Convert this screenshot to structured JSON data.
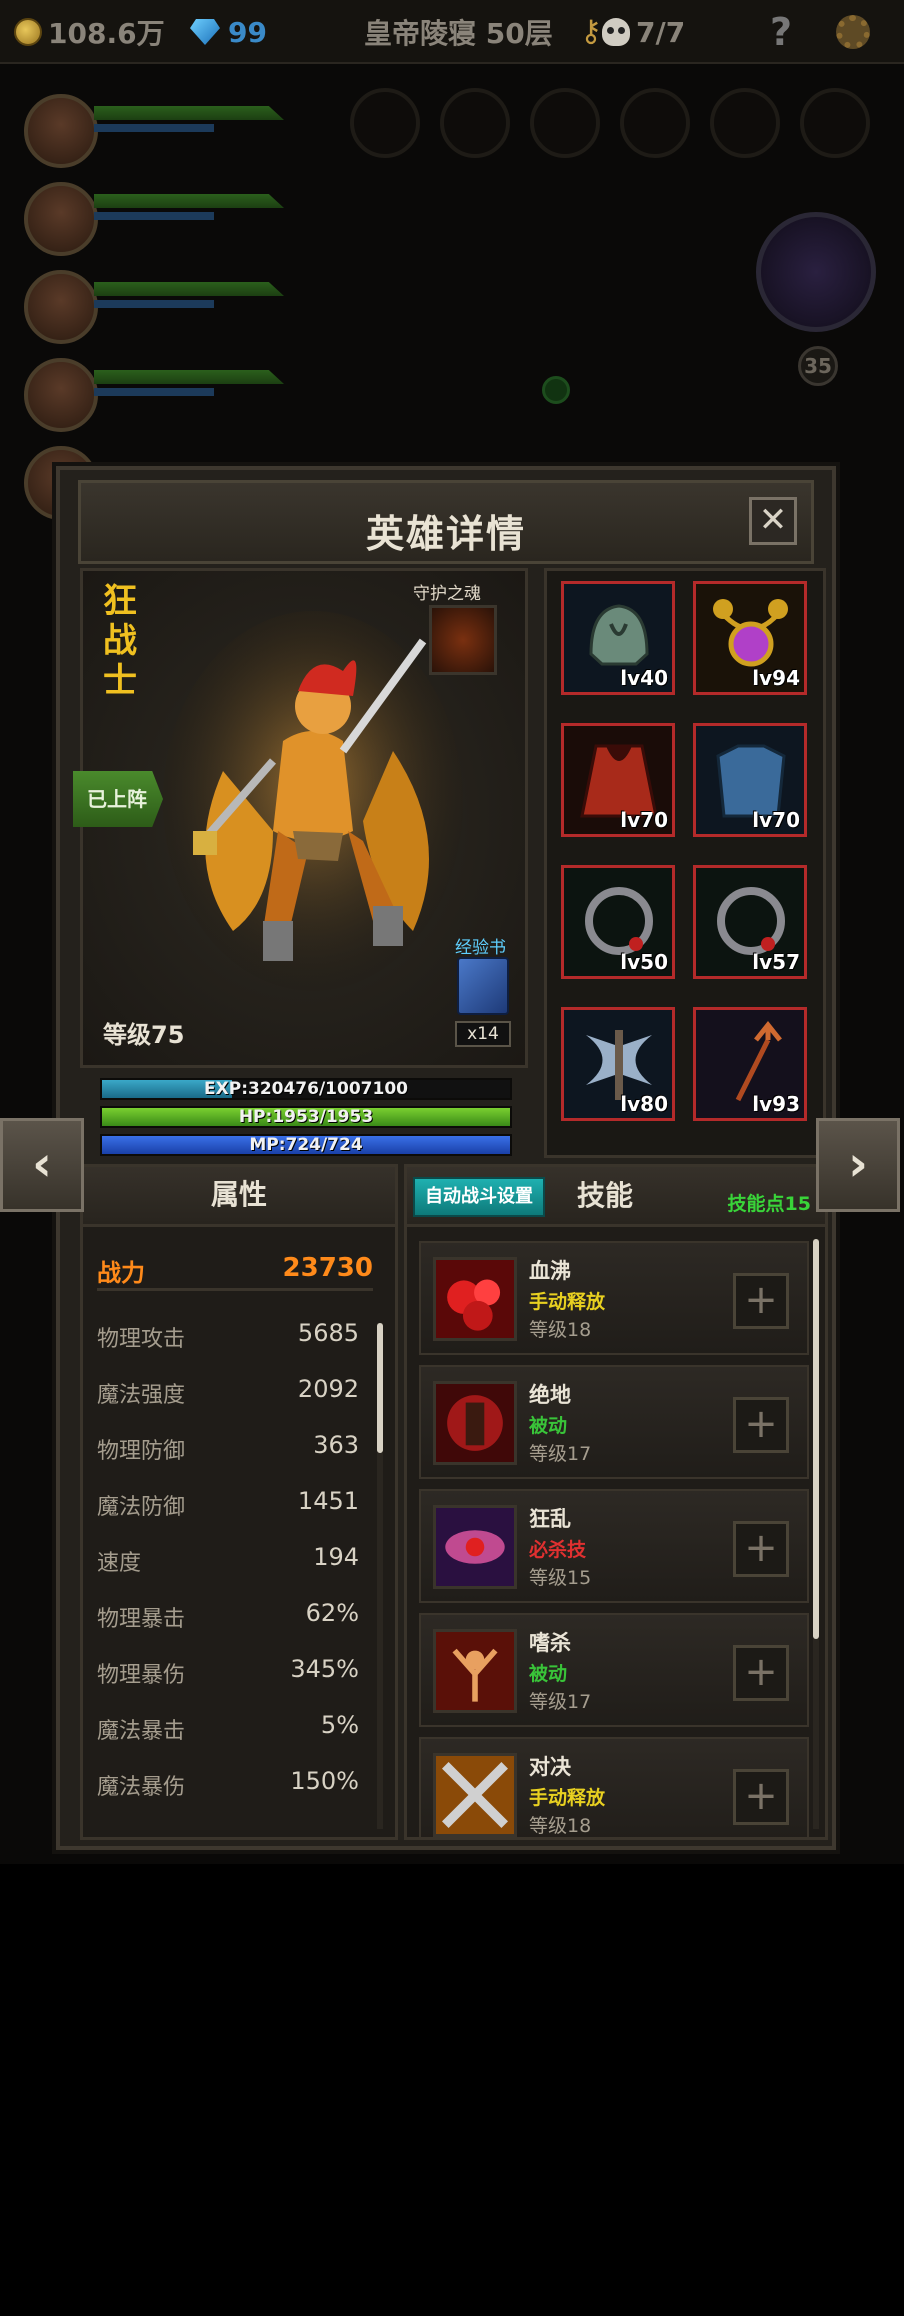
{
  "topbar": {
    "gold": "108.6万",
    "gems": "99",
    "location": "皇帝陵寝 50层",
    "keys": "7/7"
  },
  "background": {
    "companion_level": "35"
  },
  "panel": {
    "title": "英雄详情",
    "close_glyph": "✕"
  },
  "hero": {
    "name_chars": [
      "狂",
      "战",
      "士"
    ],
    "deployed_label": "已上阵",
    "guardian_label": "守护之魂",
    "exp_book_label": "经验书",
    "exp_book_count": "x14",
    "level_label": "等级75",
    "exp_text": "EXP:320476/1007100",
    "exp_fraction": 0.318,
    "hp_text": "HP:1953/1953",
    "hp_fraction": 1.0,
    "mp_text": "MP:724/724",
    "mp_fraction": 1.0
  },
  "equipment": [
    {
      "name": "helmet",
      "level": "lv40"
    },
    {
      "name": "amulet",
      "level": "lv94"
    },
    {
      "name": "cloak",
      "level": "lv70"
    },
    {
      "name": "armor",
      "level": "lv70"
    },
    {
      "name": "ring",
      "level": "lv50"
    },
    {
      "name": "ring",
      "level": "lv57"
    },
    {
      "name": "axe",
      "level": "lv80"
    },
    {
      "name": "trident",
      "level": "lv93"
    }
  ],
  "attributes": {
    "header": "属性",
    "power_label": "战力",
    "power_value": "23730",
    "stats": [
      {
        "label": "物理攻击",
        "value": "5685"
      },
      {
        "label": "魔法强度",
        "value": "2092"
      },
      {
        "label": "物理防御",
        "value": "363"
      },
      {
        "label": "魔法防御",
        "value": "1451"
      },
      {
        "label": "速度",
        "value": "194"
      },
      {
        "label": "物理暴击",
        "value": "62%"
      },
      {
        "label": "物理暴伤",
        "value": "345%"
      },
      {
        "label": "魔法暴击",
        "value": "5%"
      },
      {
        "label": "魔法暴伤",
        "value": "150%"
      }
    ]
  },
  "skills": {
    "auto_battle_label": "自动战斗设置",
    "header": "技能",
    "points_label": "技能点15",
    "plus_glyph": "+",
    "list": [
      {
        "name": "血沸",
        "type": "手动释放",
        "type_color": "#e8d020",
        "level": "等级18"
      },
      {
        "name": "绝地",
        "type": "被动",
        "type_color": "#39c439",
        "level": "等级17"
      },
      {
        "name": "狂乱",
        "type": "必杀技",
        "type_color": "#e03030",
        "level": "等级15"
      },
      {
        "name": "嗜杀",
        "type": "被动",
        "type_color": "#39c439",
        "level": "等级17"
      },
      {
        "name": "对决",
        "type": "手动释放",
        "type_color": "#e8d020",
        "level": "等级18"
      }
    ]
  },
  "nav": {
    "prev_glyph": "‹",
    "next_glyph": "›"
  }
}
